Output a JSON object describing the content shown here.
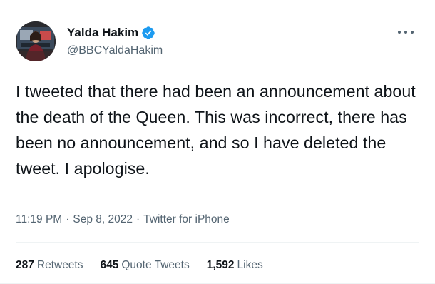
{
  "author": {
    "display_name": "Yalda Hakim",
    "handle": "@BBCYaldaHakim",
    "verified": true,
    "avatar_icon": "user-photo-avatar"
  },
  "tweet": {
    "text": "I tweeted that there had been an announcement about the death of the Queen. This was incorrect, there has been no announcement, and so I have deleted the tweet. I apologise.",
    "time": "11:19 PM",
    "separator": "·",
    "date": "Sep 8, 2022",
    "source": "Twitter for iPhone"
  },
  "stats": {
    "retweets": {
      "count": "287",
      "label": "Retweets"
    },
    "quote_tweets": {
      "count": "645",
      "label": "Quote Tweets"
    },
    "likes": {
      "count": "1,592",
      "label": "Likes"
    }
  },
  "colors": {
    "text_primary": "#0f1419",
    "text_secondary": "#536471",
    "verified_blue": "#1d9bf0",
    "divider": "#eff3f4"
  },
  "icons": {
    "verified": "verified-badge-icon",
    "more": "more-options-icon"
  }
}
